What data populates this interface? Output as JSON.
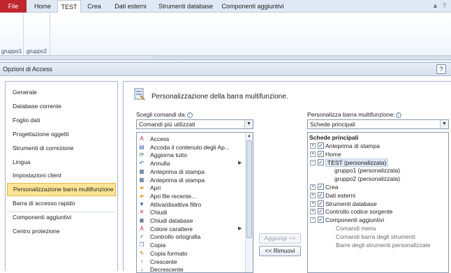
{
  "ribbon": {
    "tabs": [
      {
        "label": "File"
      },
      {
        "label": "Home"
      },
      {
        "label": "TEST"
      },
      {
        "label": "Crea"
      },
      {
        "label": "Dati esterni"
      },
      {
        "label": "Strumenti database"
      },
      {
        "label": "Componenti aggiuntivi"
      }
    ],
    "active_tab": "TEST",
    "groups": [
      {
        "label": "gruppo1"
      },
      {
        "label": "gruppo2"
      }
    ],
    "window_buttons": [
      "▲",
      "?"
    ]
  },
  "dialog": {
    "title": "Opzioni di Access",
    "help_glyph": "?",
    "nav": [
      {
        "label": "Generale"
      },
      {
        "label": "Database corrente"
      },
      {
        "label": "Foglio dati"
      },
      {
        "label": "Progettazione oggetti"
      },
      {
        "label": "Strumenti di correzione"
      },
      {
        "label": "Lingua"
      },
      {
        "label": "Impostazioni client"
      },
      {
        "label": "Personalizzazione barra multifunzione"
      },
      {
        "label": "Barra di accesso rapido"
      },
      {
        "label": "Componenti aggiuntivi"
      },
      {
        "label": "Centro protezione"
      }
    ],
    "selected_nav": "Personalizzazione barra multifunzione",
    "header_title": "Personalizzazione della barra multifunzione.",
    "choose_label": "Scegli comandi da:",
    "choose_value": "Comandi più utilizzati",
    "customize_label": "Personalizza barra multifunzione:",
    "customize_value": "Schede principali",
    "commands": [
      {
        "label": "Access",
        "icon": "access-icon"
      },
      {
        "label": "Accoda il contenuto degli Ap...",
        "icon": "append-icon"
      },
      {
        "label": "Aggiorna tutto",
        "icon": "refresh-icon"
      },
      {
        "label": "Annulla",
        "icon": "undo-icon",
        "submenu": true
      },
      {
        "label": "Anteprima di stampa",
        "icon": "print-preview-icon"
      },
      {
        "label": "Anteprima di stampa",
        "icon": "print-preview-icon"
      },
      {
        "label": "Apri",
        "icon": "folder-icon"
      },
      {
        "label": "Apri file recente...",
        "icon": "folder-icon"
      },
      {
        "label": "Attiva/disattiva filtro",
        "icon": "filter-icon"
      },
      {
        "label": "Chiudi",
        "icon": "close-icon"
      },
      {
        "label": "Chiudi database",
        "icon": "close-db-icon"
      },
      {
        "label": "Colore carattere",
        "icon": "font-color-icon",
        "submenu": true
      },
      {
        "label": "Controllo ortografia",
        "icon": "spelling-icon"
      },
      {
        "label": "Copia",
        "icon": "copy-icon"
      },
      {
        "label": "Copia formato",
        "icon": "format-painter-icon"
      },
      {
        "label": "Crescente",
        "icon": "sort-asc-icon"
      },
      {
        "label": "Decrescente",
        "icon": "sort-desc-icon"
      }
    ],
    "add_button": "Aggiungi >>",
    "remove_button": "<< Rimuovi",
    "tree_header": "Schede principali",
    "tree": [
      {
        "label": "Anteprima di stampa",
        "level": 1,
        "expander": "+",
        "checked": true
      },
      {
        "label": "Home",
        "level": 1,
        "expander": "+",
        "checked": true
      },
      {
        "label": "TEST (personalizzata)",
        "level": 1,
        "expander": "-",
        "checked": true,
        "selected": true
      },
      {
        "label": "gruppo1 (personalizzata)",
        "level": 2
      },
      {
        "label": "gruppo2 (personalizzata)",
        "level": 2
      },
      {
        "label": "Crea",
        "level": 1,
        "expander": "+",
        "checked": true
      },
      {
        "label": "Dati esterni",
        "level": 1,
        "expander": "+",
        "checked": true
      },
      {
        "label": "Strumenti database",
        "level": 1,
        "expander": "+",
        "checked": true
      },
      {
        "label": "Controllo codice sorgente",
        "level": 1,
        "expander": "+",
        "checked": true
      },
      {
        "label": "Componenti aggiuntivi",
        "level": 1,
        "expander": "-",
        "checked": true
      },
      {
        "label": "Comandi menu",
        "level": 2,
        "disabled": true
      },
      {
        "label": "Comandi barra degli strumenti",
        "level": 2,
        "disabled": true
      },
      {
        "label": "Barre degli strumenti personalizzate",
        "level": 2,
        "disabled": true
      }
    ]
  }
}
